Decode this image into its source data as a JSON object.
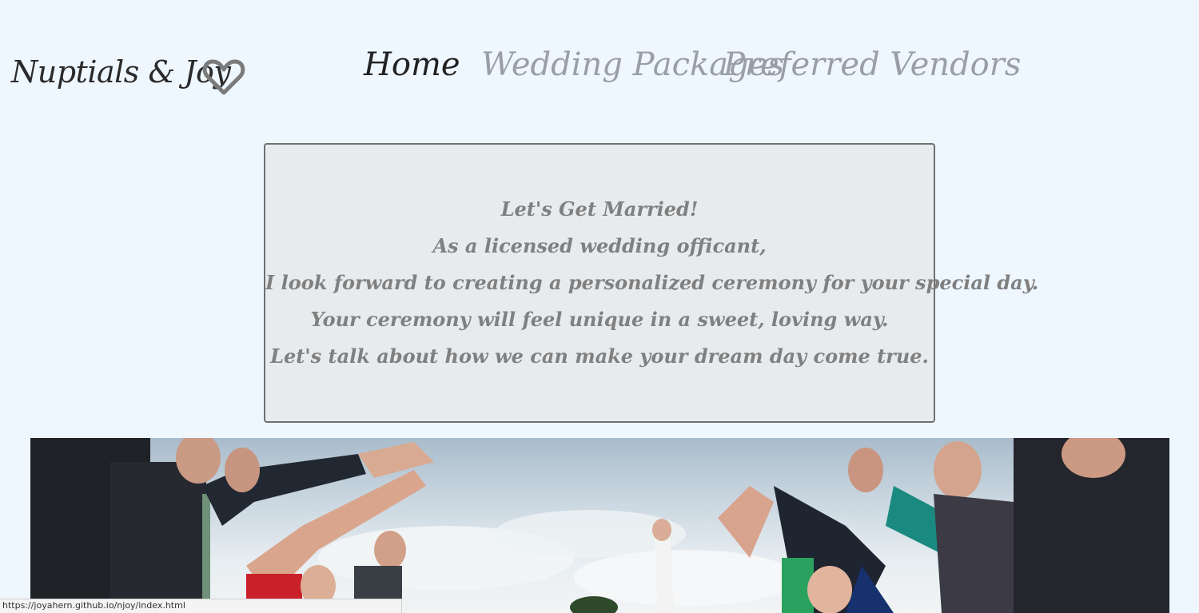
{
  "header": {
    "brand": "Nuptials & Joy",
    "logo_icon": "heart-outline-icon",
    "nav": [
      {
        "label": "Home",
        "active": true
      },
      {
        "label": "Wedding Packages",
        "active": false
      },
      {
        "label": "Preferred Vendors",
        "active": false
      }
    ]
  },
  "intro": {
    "lines": [
      "Let's Get Married!",
      "As a licensed wedding officant,",
      "I look forward to creating a personalized ceremony for your special day.",
      "Your ceremony will feel unique in a sweet, loving way.",
      "Let's talk about how we can make your dream day come true."
    ]
  },
  "status_bar": {
    "url": "https://joyahern.github.io/njoy/index.html"
  },
  "colors": {
    "page_background": "#eef6fe",
    "active_nav": "#222222",
    "inactive_nav": "#9a9ea6",
    "intro_text": "#808080",
    "intro_box_background": "#e8ebee",
    "intro_box_border": "#707070"
  }
}
